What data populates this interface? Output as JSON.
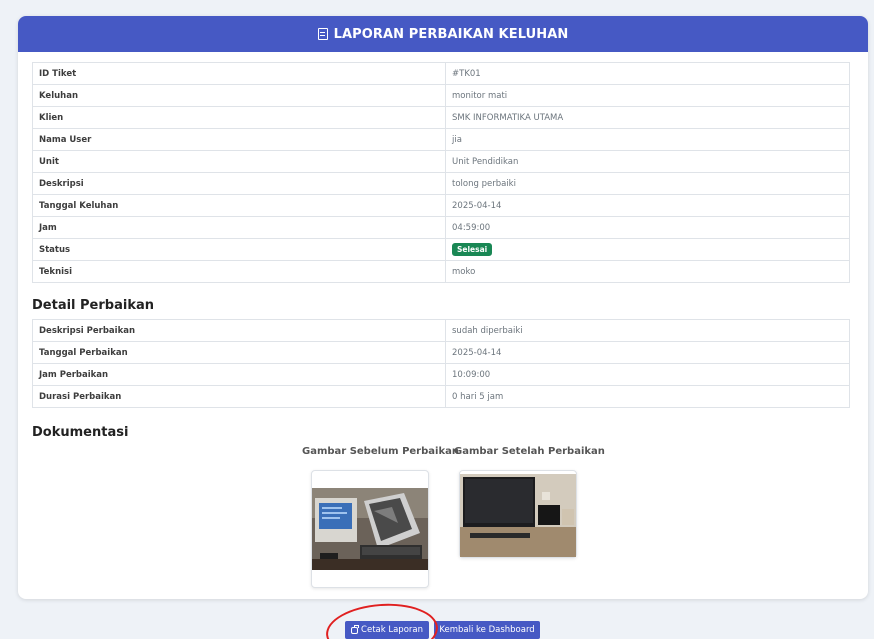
{
  "header": {
    "title": "LAPORAN PERBAIKAN KELUHAN"
  },
  "ticket_rows": [
    {
      "label": "ID Tiket",
      "value": "#TK01"
    },
    {
      "label": "Keluhan",
      "value": "monitor mati"
    },
    {
      "label": "Klien",
      "value": "SMK INFORMATIKA UTAMA"
    },
    {
      "label": "Nama User",
      "value": "jia"
    },
    {
      "label": "Unit",
      "value": "Unit Pendidikan"
    },
    {
      "label": "Deskripsi",
      "value": "tolong perbaiki"
    },
    {
      "label": "Tanggal Keluhan",
      "value": "2025-04-14"
    },
    {
      "label": "Jam",
      "value": "04:59:00"
    },
    {
      "label": "Status",
      "value": "Selesai"
    },
    {
      "label": "Teknisi",
      "value": "moko"
    }
  ],
  "detail": {
    "title": "Detail Perbaikan",
    "rows": [
      {
        "label": "Deskripsi Perbaikan",
        "value": "sudah diperbaiki"
      },
      {
        "label": "Tanggal Perbaikan",
        "value": "2025-04-14"
      },
      {
        "label": "Jam Perbaikan",
        "value": "10:09:00"
      },
      {
        "label": "Durasi Perbaikan",
        "value": "0 hari 5 jam"
      }
    ]
  },
  "documentation": {
    "title": "Dokumentasi",
    "before_label": "Gambar Sebelum Perbaikan",
    "after_label": "Gambar Setelah Perbaikan"
  },
  "actions": {
    "print_label": "Cetak Laporan",
    "back_label": "Kembali ke Dashboard"
  },
  "colors": {
    "primary": "#4659c4",
    "status_success": "#198754",
    "annotation_circle": "#e02020"
  },
  "icons": {
    "header": "document-icon",
    "print": "printer-icon"
  }
}
